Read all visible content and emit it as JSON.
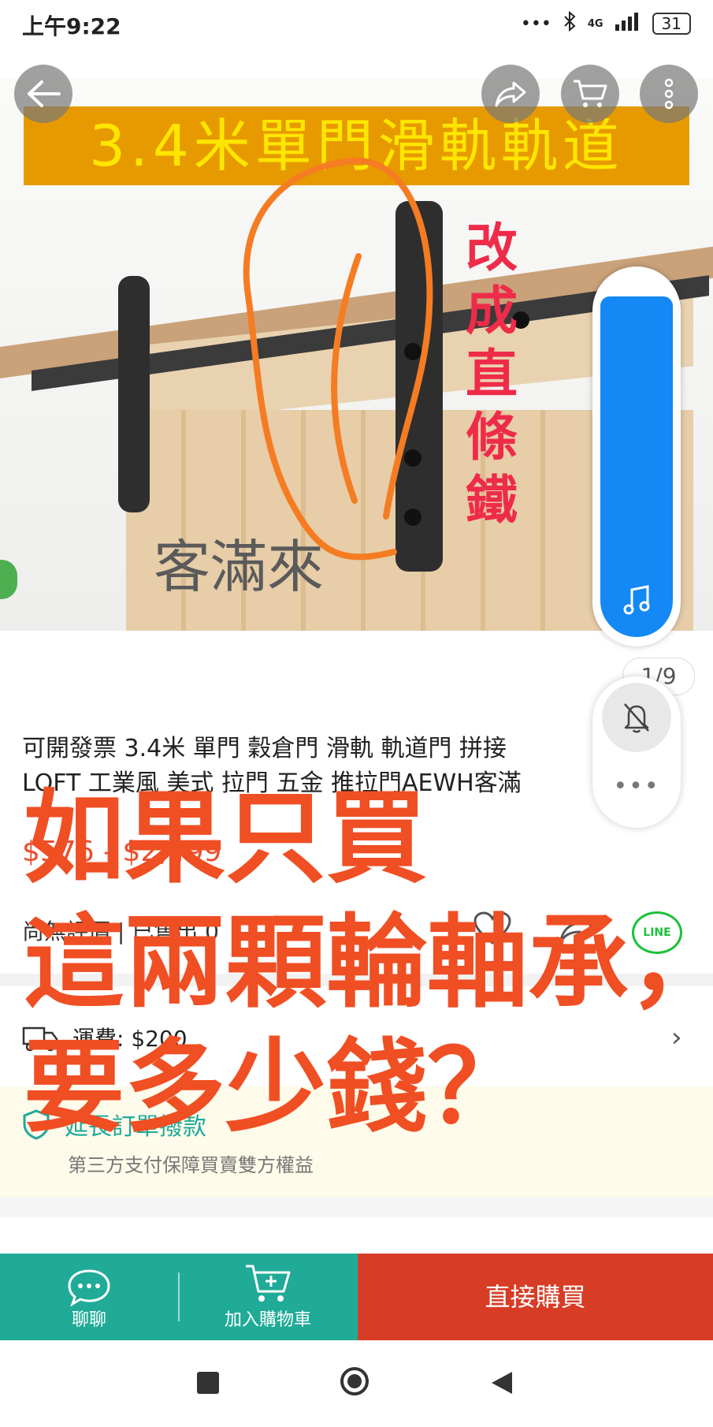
{
  "status_bar": {
    "time": "上午9:22",
    "signal_dots": "•••",
    "network": "4G",
    "battery": "31"
  },
  "hero": {
    "banner_text": "3.4米單門滑軌軌道",
    "watermark": "客滿來",
    "page_indicator": "1/9"
  },
  "toolbar": {
    "back_icon": "arrow-left-icon",
    "share_icon": "share-icon",
    "cart_icon": "cart-icon",
    "more_icon": "more-vertical-icon"
  },
  "product": {
    "title_line1": "可開發票 3.4米 單門 穀倉門 滑軌 軌道門 拼接",
    "title_line2": "LOFT 工業風 美式 拉門 五金 推拉門AEWH客滿",
    "price": "$576 - $2,499",
    "rating_text": "尚無評價 | 已售出 0"
  },
  "shipping": {
    "label": "運費: $200"
  },
  "warranty": {
    "title": "延長訂單撥款",
    "subtitle": "第三方支付保障買賣雙方權益"
  },
  "annotations": {
    "vertical": "改成直條鐵",
    "big_line1": "如果只買",
    "big_line2": "這兩顆輪軸承，",
    "big_line3": "要多少錢？"
  },
  "actions": {
    "chat_label": "聊聊",
    "cart_label": "加入購物車",
    "buy_label": "直接購買"
  },
  "colors": {
    "accent": "#1fab98",
    "buy": "#d73c25",
    "price": "#ee4d2d",
    "music": "#1488f5",
    "annotation": "#f04e23"
  }
}
